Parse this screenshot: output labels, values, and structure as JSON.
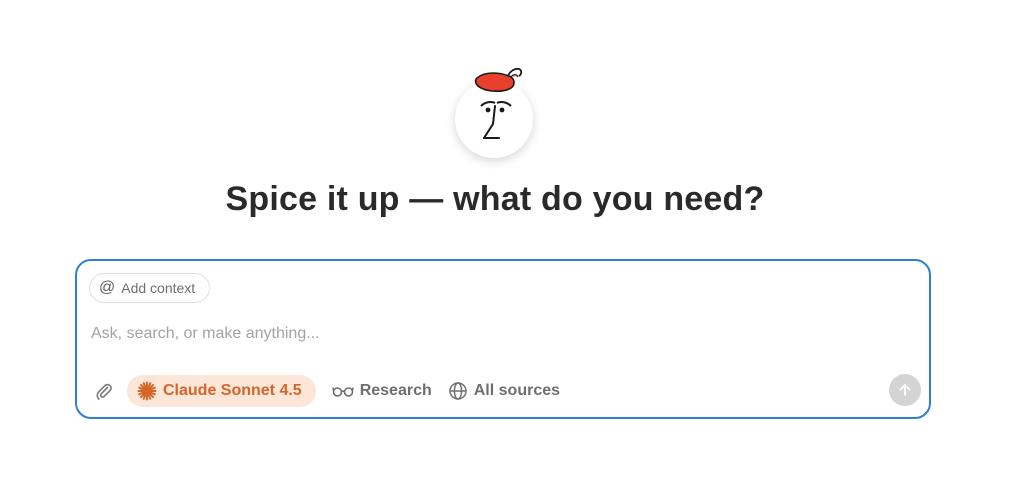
{
  "hero": {
    "avatar_icon": "chili-face-avatar",
    "headline": "Spice it up — what do you need?"
  },
  "composer": {
    "context_chip_label": "Add context",
    "context_icon": "at-sign-icon",
    "placeholder": "Ask, search, or make anything...",
    "value": "",
    "attach_icon": "paperclip-icon",
    "model_label": "Claude Sonnet 4.5",
    "model_icon": "claude-starburst-icon",
    "research_label": "Research",
    "research_icon": "glasses-icon",
    "sources_label": "All sources",
    "sources_icon": "globe-icon",
    "send_icon": "arrow-up-icon"
  },
  "colors": {
    "accent_border": "#2f7fd6",
    "model_pill_bg": "#fbe6d8",
    "model_pill_text": "#d4662b",
    "chili_red": "#e8402c",
    "send_disabled": "#d4d4d4"
  }
}
